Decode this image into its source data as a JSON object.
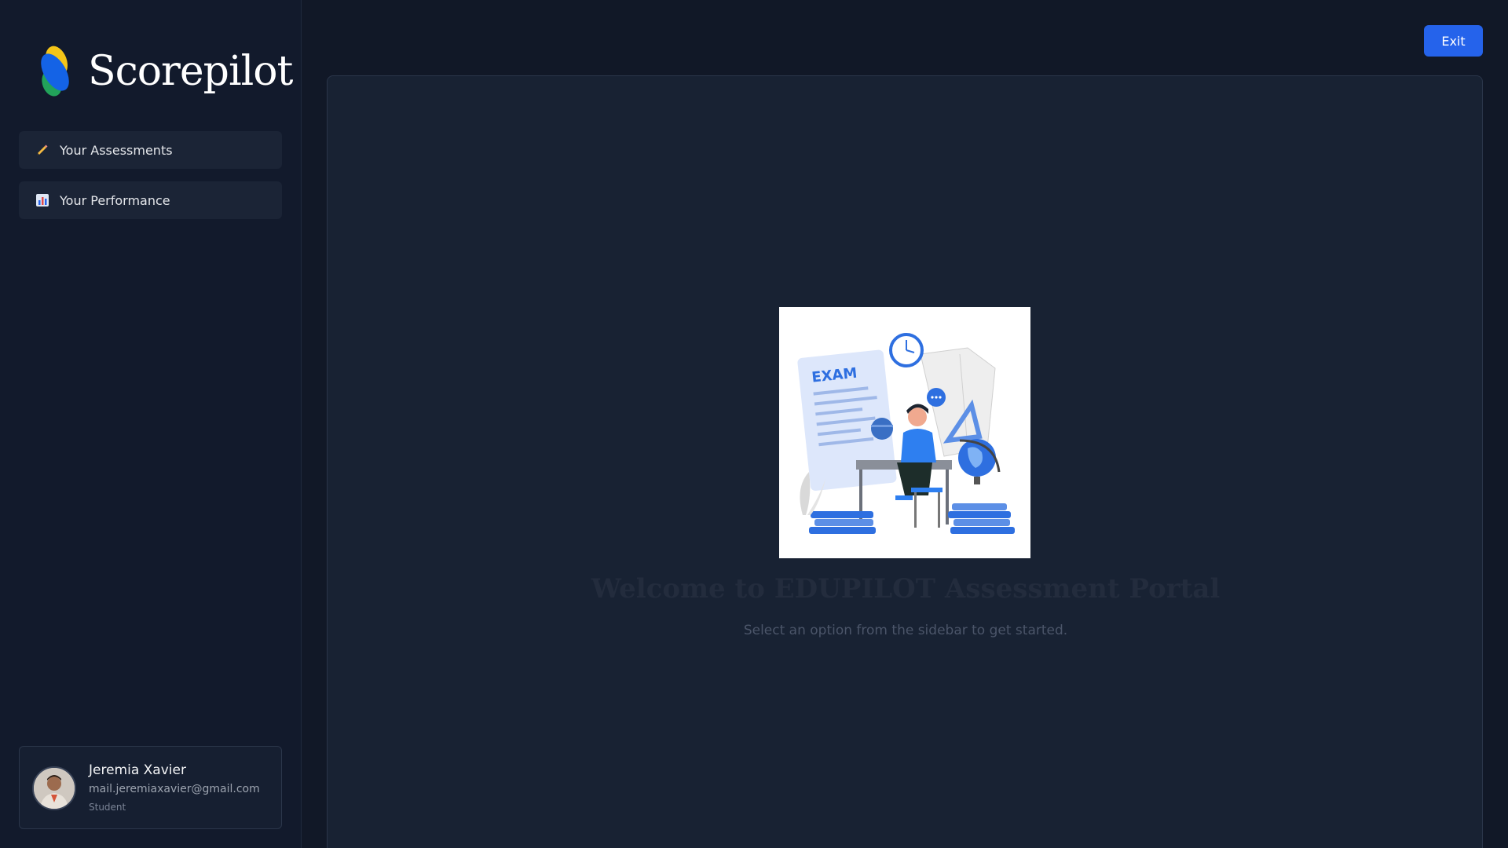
{
  "brand": {
    "name": "Scorepilot"
  },
  "sidebar": {
    "items": [
      {
        "label": "Your Assessments",
        "icon": "pencil-icon"
      },
      {
        "label": "Your Performance",
        "icon": "bar-chart-icon"
      }
    ]
  },
  "user": {
    "name": "Jeremia Xavier",
    "email": "mail.jeremiaxavier@gmail.com",
    "role": "Student"
  },
  "header": {
    "exit_label": "Exit"
  },
  "main": {
    "illustration_text": "EXAM",
    "welcome_title": "Welcome to EDUPILOT Assessment Portal",
    "welcome_subtitle": "Select an option from the sidebar to get started."
  },
  "colors": {
    "background": "#111827",
    "sidebar": "#121a2c",
    "panel": "#182233",
    "accent": "#2563eb"
  }
}
